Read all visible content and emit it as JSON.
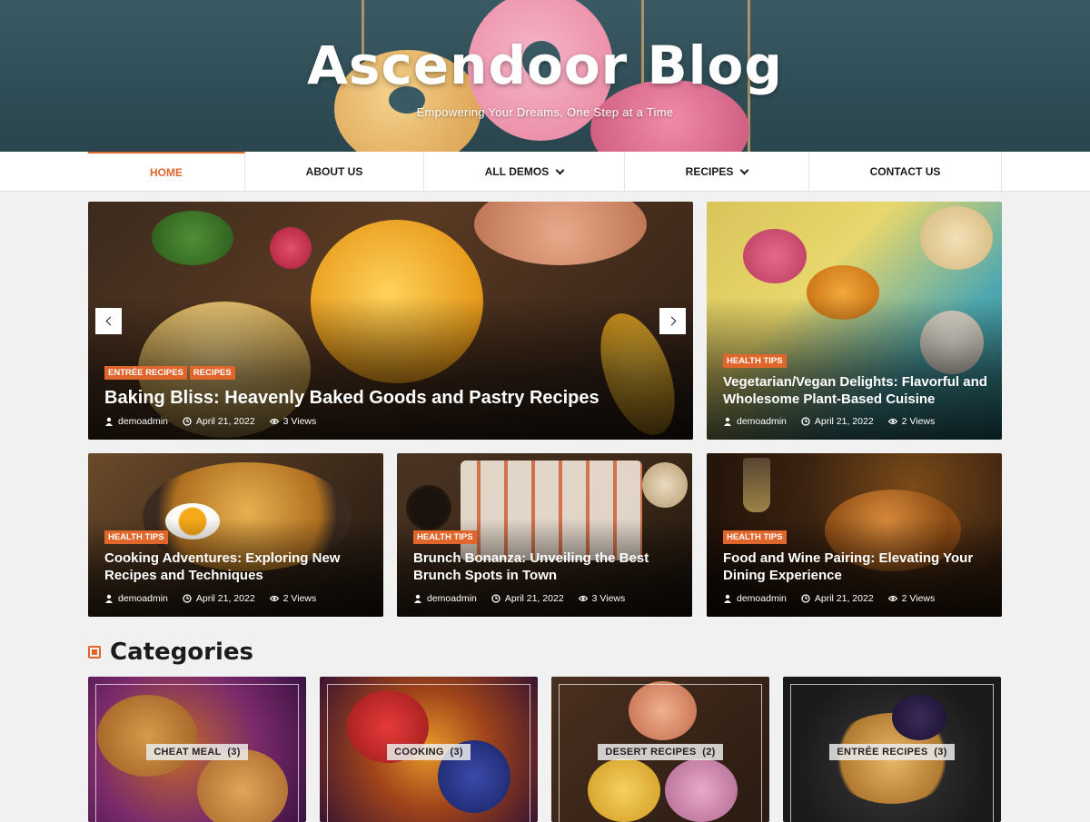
{
  "site": {
    "title": "Ascendoor Blog",
    "tagline": "Empowering Your Dreams, One Step at a Time"
  },
  "nav": [
    {
      "label": "HOME",
      "active": true
    },
    {
      "label": "ABOUT US"
    },
    {
      "label": "ALL DEMOS",
      "dropdown": true
    },
    {
      "label": "RECIPES",
      "dropdown": true
    },
    {
      "label": "CONTACT US"
    }
  ],
  "featured": {
    "badges": [
      "ENTRÉE RECIPES",
      "RECIPES"
    ],
    "title": "Baking Bliss: Heavenly Baked Goods and Pastry Recipes",
    "author": "demoadmin",
    "date": "April 21, 2022",
    "views": "3 Views"
  },
  "side_post": {
    "badge": "HEALTH TIPS",
    "title": "Vegetarian/Vegan Delights: Flavorful and Wholesome Plant-Based Cuisine",
    "author": "demoadmin",
    "date": "April 21, 2022",
    "views": "2 Views"
  },
  "posts": [
    {
      "badge": "HEALTH TIPS",
      "title": "Cooking Adventures: Exploring New Recipes and Techniques",
      "author": "demoadmin",
      "date": "April 21, 2022",
      "views": "2 Views"
    },
    {
      "badge": "HEALTH TIPS",
      "title": "Brunch Bonanza: Unveiling the Best Brunch Spots in Town",
      "author": "demoadmin",
      "date": "April 21, 2022",
      "views": "3 Views"
    },
    {
      "badge": "HEALTH TIPS",
      "title": "Food and Wine Pairing: Elevating Your Dining Experience",
      "author": "demoadmin",
      "date": "April 21, 2022",
      "views": "2 Views"
    }
  ],
  "categories": {
    "heading": "Categories",
    "items": [
      {
        "label": "CHEAT MEAL",
        "count": "(3)"
      },
      {
        "label": "COOKING",
        "count": "(3)"
      },
      {
        "label": "DESERT RECIPES",
        "count": "(2)"
      },
      {
        "label": "ENTRÉE RECIPES",
        "count": "(3)"
      }
    ]
  },
  "icons": {
    "author": "user-icon",
    "date": "clock-icon",
    "views": "eye-icon",
    "prev": "chevron-left-icon",
    "next": "chevron-right-icon"
  },
  "colors": {
    "accent": "#e0662c",
    "header_bg": "#3a5a63"
  }
}
